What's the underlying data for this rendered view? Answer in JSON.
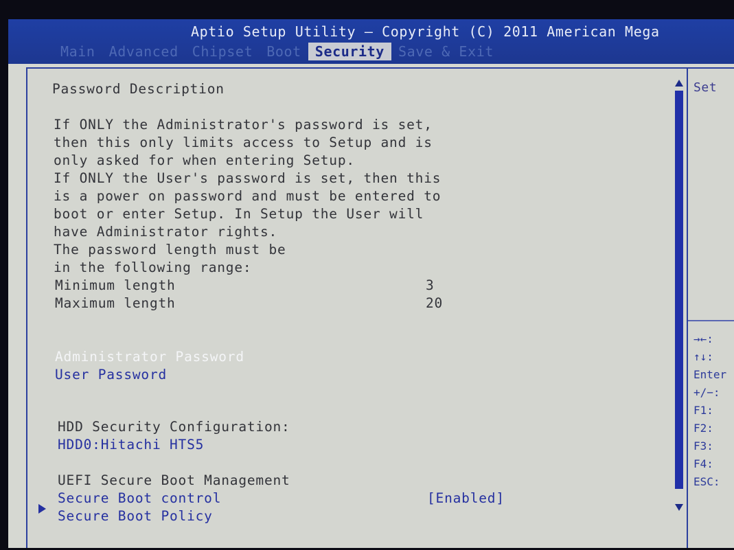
{
  "header": {
    "title": "Aptio Setup Utility – Copyright (C) 2011 American Mega"
  },
  "tabs": [
    {
      "label": "Main"
    },
    {
      "label": "Advanced"
    },
    {
      "label": "Chipset"
    },
    {
      "label": "Boot"
    },
    {
      "label": "Security"
    },
    {
      "label": "Save & Exit"
    }
  ],
  "main": {
    "heading": "Password Description",
    "description": [
      "If ONLY the Administrator's password is set,",
      "then this only limits access to Setup and is",
      "only asked for when entering Setup.",
      "If ONLY the User's password is set, then this",
      "is a power on password and must be entered to",
      "boot or enter Setup. In Setup the User will",
      "have Administrator rights.",
      "The password length must be",
      "in the following range:"
    ],
    "min_label": "Minimum length",
    "min_value": "3",
    "max_label": "Maximum length",
    "max_value": "20",
    "admin_password": "Administrator Password",
    "user_password": "User Password",
    "hdd_heading": "HDD Security Configuration:",
    "hdd_item": "HDD0:Hitachi HTS5",
    "uefi_heading": "UEFI Secure Boot Management",
    "secure_boot_control": "Secure Boot control",
    "secure_boot_value": "[Enabled]",
    "secure_boot_policy": "Secure Boot Policy"
  },
  "side": {
    "help_title": "Set",
    "keys": [
      "→←:",
      "↑↓:",
      "Enter",
      "+/−:",
      "F1:",
      "F2:",
      "F3:",
      "F4:",
      "ESC:"
    ]
  },
  "colors": {
    "title_bar": "#1f3fa4",
    "panel_bg": "#d4d6d0",
    "link": "#2530a0",
    "selected": "#f4f5f7"
  }
}
